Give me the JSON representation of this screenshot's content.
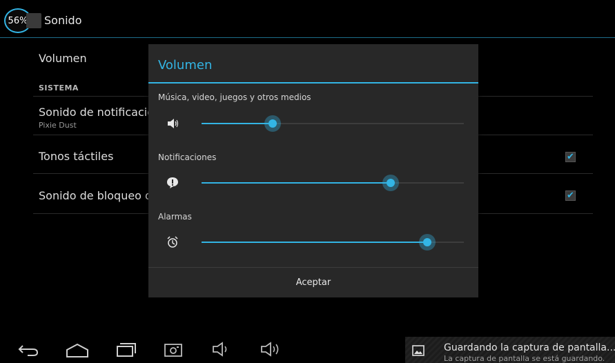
{
  "status": {
    "battery_percent": "56%"
  },
  "actionbar": {
    "title": "Sonido"
  },
  "settings": {
    "volume_label": "Volumen",
    "section_header": "SISTEMA",
    "notification_sound": {
      "title": "Sonido de notificación",
      "value": "Pixie Dust"
    },
    "touch_tones": {
      "title": "Tonos táctiles",
      "checked": true
    },
    "lock_sound": {
      "title": "Sonido de bloqueo de p",
      "checked": true
    }
  },
  "dialog": {
    "title": "Volumen",
    "streams": [
      {
        "label": "Música, video, juegos y otros medios",
        "icon": "speaker-icon",
        "level": 0.27
      },
      {
        "label": "Notificaciones",
        "icon": "notification-icon",
        "level": 0.72
      },
      {
        "label": "Alarmas",
        "icon": "alarm-clock-icon",
        "level": 0.86
      }
    ],
    "ok_label": "Aceptar"
  },
  "notification": {
    "title": "Guardando la captura de pantalla...",
    "subtitle": "La captura de pantalla se está guardando."
  },
  "colors": {
    "accent": "#33b5e5",
    "background": "#000000",
    "dialog": "#282828"
  }
}
